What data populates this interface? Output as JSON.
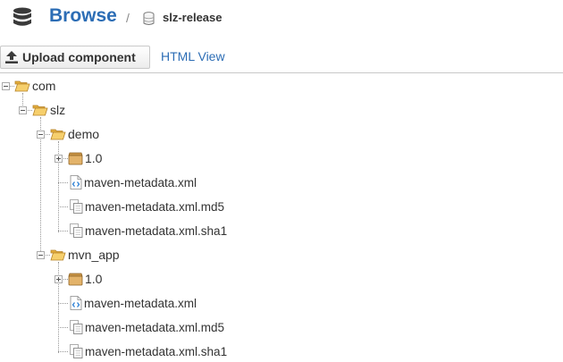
{
  "header": {
    "title": "Browse",
    "separator": "/",
    "repository": "slz-release"
  },
  "toolbar": {
    "upload_label": "Upload component",
    "html_view_label": "HTML View"
  },
  "tree": {
    "root": "com",
    "group": "slz",
    "artifacts": [
      {
        "name": "demo",
        "version": "1.0",
        "files": [
          "maven-metadata.xml",
          "maven-metadata.xml.md5",
          "maven-metadata.xml.sha1"
        ]
      },
      {
        "name": "mvn_app",
        "version": "1.0",
        "files": [
          "maven-metadata.xml",
          "maven-metadata.xml.md5",
          "maven-metadata.xml.sha1"
        ]
      }
    ]
  },
  "colors": {
    "accent": "#2c6db5",
    "folder": "#f0c35a",
    "package": "#d9a65a"
  },
  "icons": {
    "header": "database-icon",
    "repository": "repository-icon",
    "upload": "upload-icon",
    "folder": "folder-open-icon",
    "version": "package-icon",
    "xml": "xml-file-icon",
    "checksum": "checksum-file-icon"
  }
}
